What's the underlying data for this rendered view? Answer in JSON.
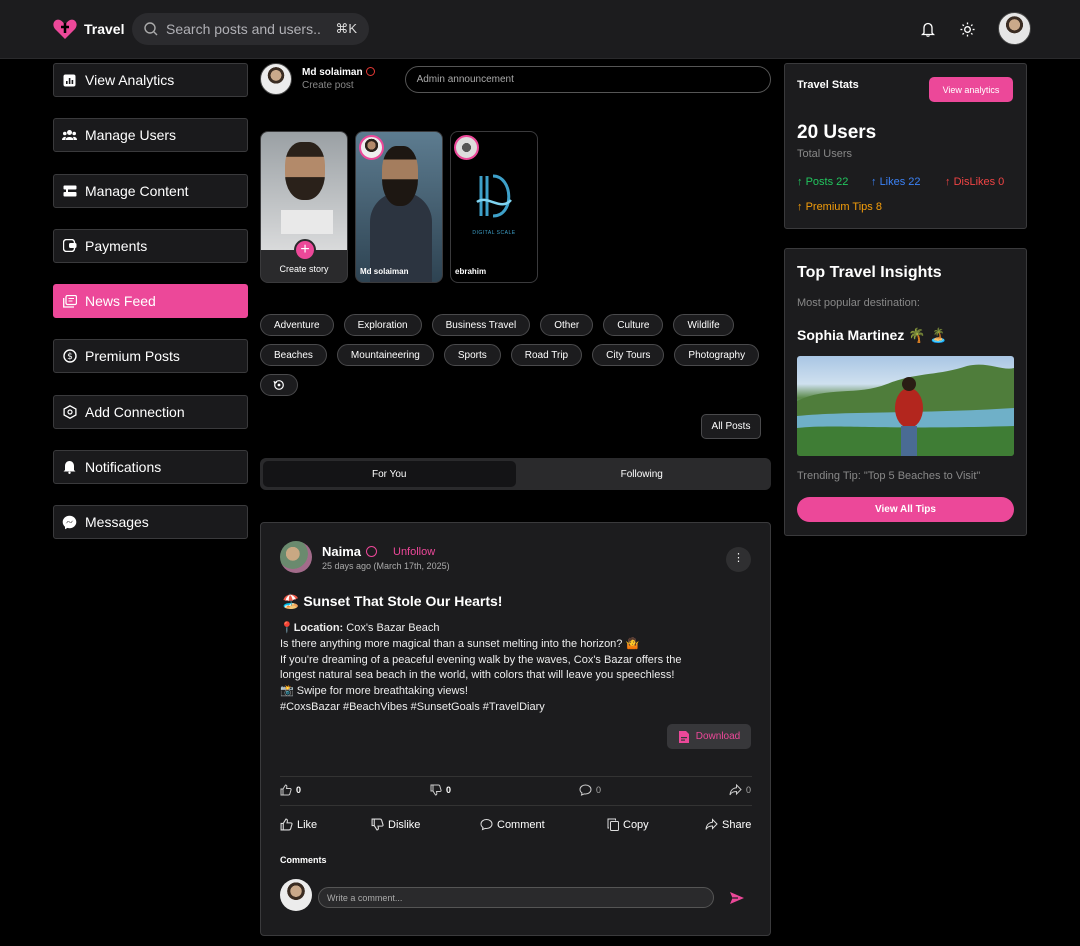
{
  "app": {
    "name": "Travel"
  },
  "search": {
    "placeholder": "Search posts and users..",
    "shortcut": "⌘K"
  },
  "sidebar": {
    "items": [
      {
        "label": "View Analytics",
        "icon": "analytics-icon"
      },
      {
        "label": "Manage Users",
        "icon": "users-icon"
      },
      {
        "label": "Manage Content",
        "icon": "content-icon"
      },
      {
        "label": "Payments",
        "icon": "payments-icon"
      },
      {
        "label": "News Feed",
        "icon": "newsfeed-icon",
        "active": true
      },
      {
        "label": "Premium Posts",
        "icon": "premium-icon"
      },
      {
        "label": "Add Connection",
        "icon": "connection-icon"
      },
      {
        "label": "Notifications",
        "icon": "bell-icon"
      },
      {
        "label": "Messages",
        "icon": "messenger-icon"
      }
    ]
  },
  "composer": {
    "name": "Md solaiman",
    "sub": "Create post",
    "placeholder": "Admin announcement"
  },
  "stories": [
    {
      "label": "Create story"
    },
    {
      "label": "Md solaiman"
    },
    {
      "label": "ebrahim",
      "logo_text": "DIGITAL SCALE"
    }
  ],
  "tags": [
    "Adventure",
    "Exploration",
    "Business Travel",
    "Other",
    "Culture",
    "Wildlife",
    "Beaches",
    "Mountaineering",
    "Sports",
    "Road Trip",
    "City Tours",
    "Photography"
  ],
  "all_posts_label": "All Posts",
  "tabs": {
    "for_you": "For You",
    "following": "Following"
  },
  "post": {
    "author": "Naima",
    "follow_label": "Unfollow",
    "time": "25 days ago (March 17th, 2025)",
    "title": "🏖️ Sunset That Stole Our Hearts!",
    "location_label": "Location:",
    "location": "Cox's Bazar Beach",
    "body_lines": [
      "Is there anything more magical than a sunset melting into the horizon? 🤷",
      "If you're dreaming of a peaceful evening walk by the waves, Cox's Bazar offers the",
      "longest natural sea beach in the world, with colors that will leave you speechless!",
      "📸 Swipe for more breathtaking views!",
      "#CoxsBazar #BeachVibes #SunsetGoals #TravelDiary"
    ],
    "download_label": "Download",
    "counts": {
      "likes": "0",
      "dislikes": "0",
      "comments": "0",
      "shares": "0"
    },
    "actions": {
      "like": "Like",
      "dislike": "Dislike",
      "comment": "Comment",
      "copy": "Copy",
      "share": "Share"
    },
    "comments_label": "Comments",
    "comment_placeholder": "Write a comment..."
  },
  "stats": {
    "title": "Travel Stats",
    "button": "View analytics",
    "users": "20 Users",
    "users_sub": "Total Users",
    "posts": "Posts 22",
    "likes": "Likes 22",
    "dislikes": "DisLikes 0",
    "premium": "Premium Tips 8",
    "colors": {
      "posts": "#22c55e",
      "likes": "#3b82f6",
      "dislikes": "#ef4444",
      "premium": "#f59e0b",
      "accent": "#ec4899"
    }
  },
  "insights": {
    "title": "Top Travel Insights",
    "sub": "Most popular destination:",
    "name": "Sophia Martinez 🌴 🏝️",
    "tip": "Trending Tip: \"Top 5 Beaches to Visit\"",
    "button": "View All Tips"
  }
}
